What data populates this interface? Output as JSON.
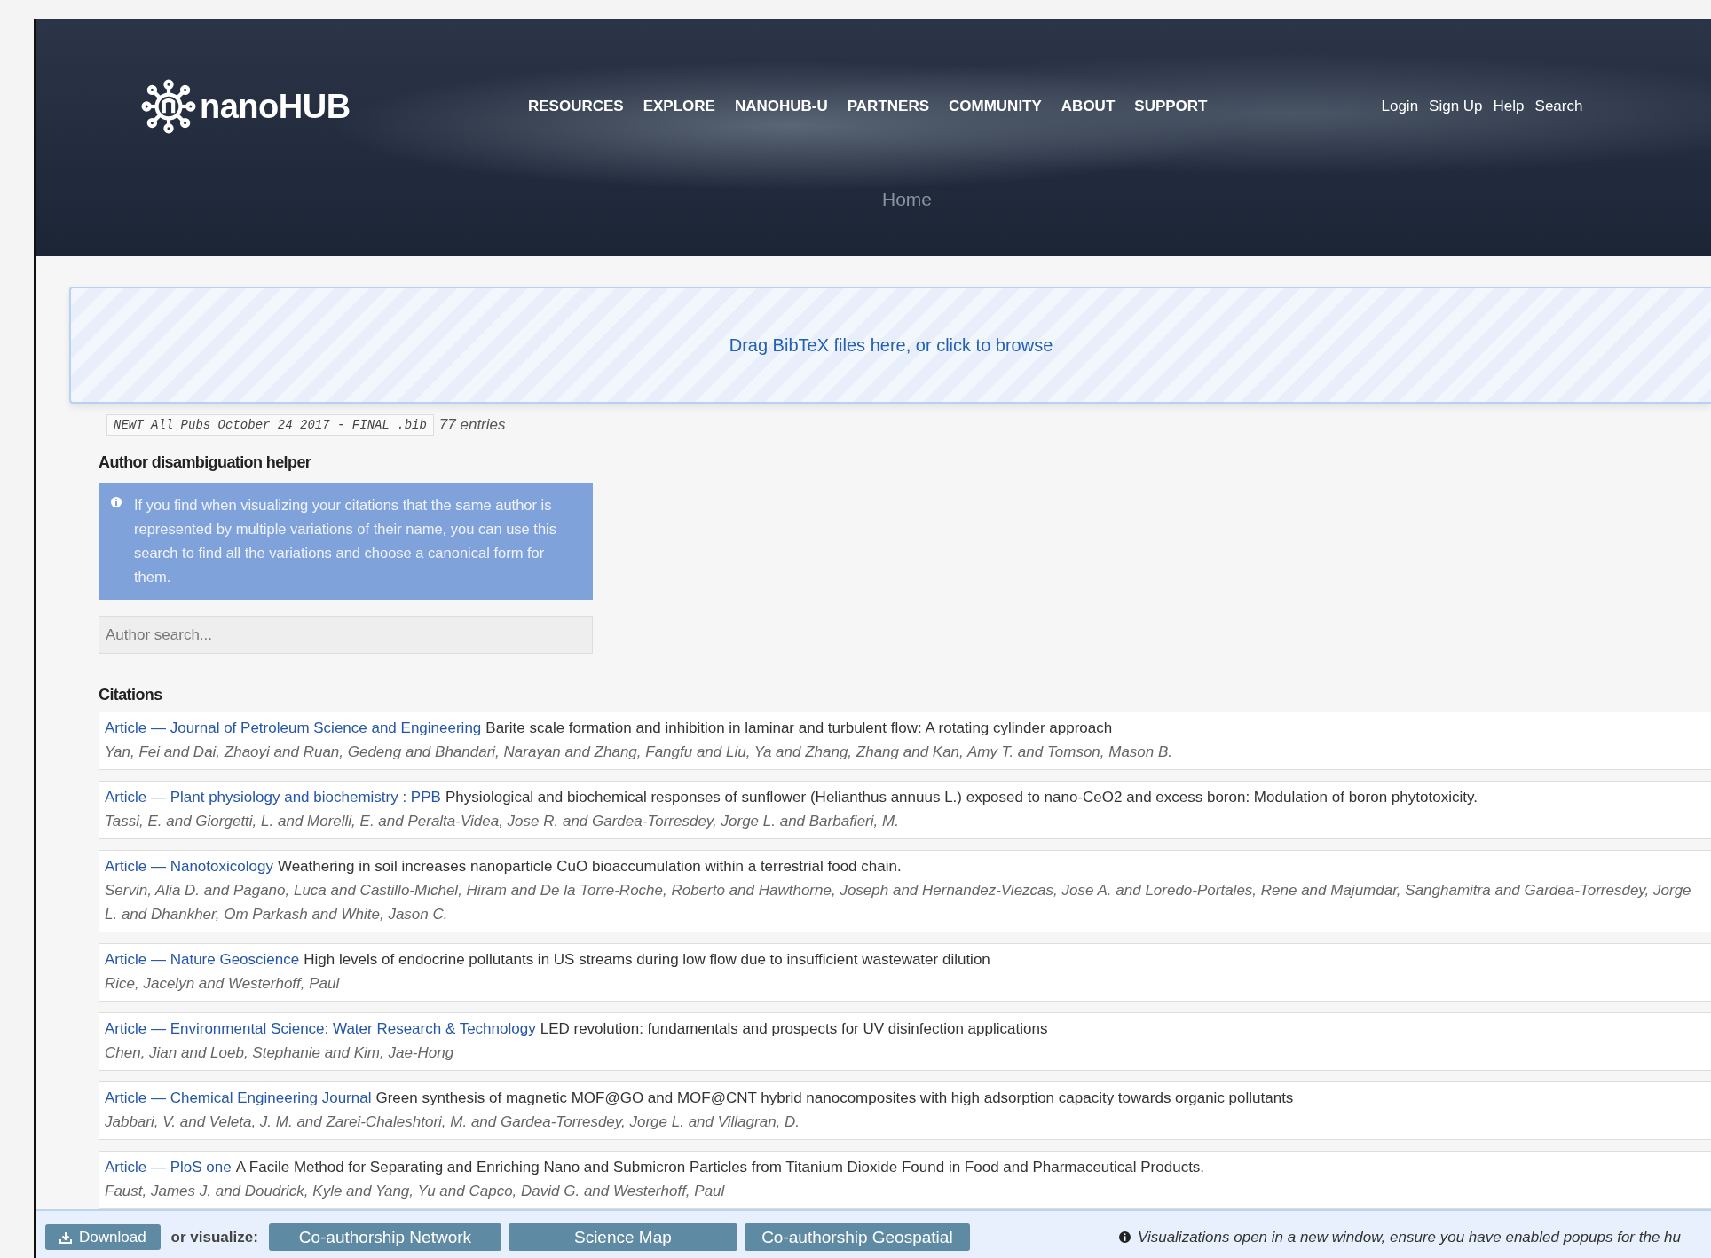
{
  "header": {
    "logo": "nanoHUB",
    "nav": [
      "RESOURCES",
      "EXPLORE",
      "NANOHUB-U",
      "PARTNERS",
      "COMMUNITY",
      "ABOUT",
      "SUPPORT"
    ],
    "user_links": [
      "Login",
      "Sign Up",
      "Help",
      "Search"
    ],
    "breadcrumb": "Home"
  },
  "dropzone": {
    "text": "Drag BibTeX files here, or click to browse"
  },
  "file": {
    "name": "NEWT All Pubs October 24 2017 - FINAL .bib",
    "count": "77 entries"
  },
  "author_helper": {
    "heading": "Author disambiguation helper",
    "info": "If you find when visualizing your citations that the same author is represented by multiple variations of their name, you can use this search to find all the variations and choose a canonical form for them.",
    "search": {
      "placeholder": "Author search..."
    }
  },
  "citations": {
    "heading": "Citations",
    "items": [
      {
        "source": "Article — Journal of Petroleum Science and Engineering",
        "title": "Barite scale formation and inhibition in laminar and turbulent flow: A rotating cylinder approach",
        "authors": "Yan, Fei and Dai, Zhaoyi and Ruan, Gedeng and Bhandari, Narayan and Zhang, Fangfu and Liu, Ya and Zhang, Zhang and Kan, Amy T. and Tomson, Mason B."
      },
      {
        "source": "Article — Plant physiology and biochemistry : PPB",
        "title": "Physiological and biochemical responses of sunflower (Helianthus annuus L.) exposed to nano-CeO2 and excess boron: Modulation of boron phytotoxicity.",
        "authors": "Tassi, E. and Giorgetti, L. and Morelli, E. and Peralta-Videa, Jose R. and Gardea-Torresdey, Jorge L. and Barbafieri, M."
      },
      {
        "source": "Article — Nanotoxicology",
        "title": "Weathering in soil increases nanoparticle CuO bioaccumulation within a terrestrial food chain.",
        "authors": "Servin, Alia D. and Pagano, Luca and Castillo-Michel, Hiram and De la Torre-Roche, Roberto and Hawthorne, Joseph and Hernandez-Viezcas, Jose A. and Loredo-Portales, Rene and Majumdar, Sanghamitra and Gardea-Torresdey, Jorge L. and Dhankher, Om Parkash and White, Jason C."
      },
      {
        "source": "Article — Nature Geoscience",
        "title": "High levels of endocrine pollutants in US streams during low flow due to insufficient wastewater dilution",
        "authors": "Rice, Jacelyn and Westerhoff, Paul"
      },
      {
        "source": "Article — Environmental Science: Water Research & Technology",
        "title": "LED revolution: fundamentals and prospects for UV disinfection applications",
        "authors": "Chen, Jian and Loeb, Stephanie and Kim, Jae-Hong"
      },
      {
        "source": "Article — Chemical Engineering Journal",
        "title": "Green synthesis of magnetic MOF@GO and MOF@CNT hybrid nanocomposites with high adsorption capacity towards organic pollutants",
        "authors": "Jabbari, V. and Veleta, J. M. and Zarei-Chaleshtori, M. and Gardea-Torresdey, Jorge L. and Villagran, D."
      },
      {
        "source": "Article — PloS one",
        "title": "A Facile Method for Separating and Enriching Nano and Submicron Particles from Titanium Dioxide Found in Food and Pharmaceutical Products.",
        "authors": "Faust, James J. and Doudrick, Kyle and Yang, Yu and Capco, David G. and Westerhoff, Paul"
      }
    ]
  },
  "footer": {
    "download": "Download",
    "visualize_label": "or visualize:",
    "buttons": [
      "Co-authorship Network",
      "Science Map",
      "Co-authorship Geospatial"
    ],
    "note": "Visualizations open in a new window, ensure you have enabled popups for the hu"
  }
}
